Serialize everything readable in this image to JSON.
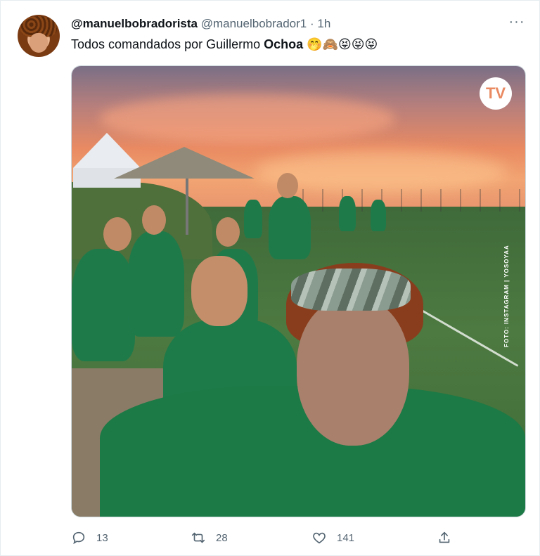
{
  "tweet": {
    "display_name": "@manuelbobradorista",
    "handle": "@manuelbobrador1",
    "separator": "·",
    "time": "1h",
    "more_label": "···",
    "text_before": "Todos comandados por Guillermo ",
    "text_bold": "Ochoa",
    "text_emojis": "🤭🙈😝😝😝"
  },
  "media": {
    "logo_text": "TV",
    "photo_credit": "FOTO: INSTAGRAM | YOSOYAA"
  },
  "actions": {
    "reply_count": "13",
    "retweet_count": "28",
    "like_count": "141"
  },
  "icons": {
    "reply": "reply-icon",
    "retweet": "retweet-icon",
    "like": "heart-icon",
    "share": "share-icon",
    "more": "more-icon"
  },
  "colors": {
    "text_primary": "#0f1419",
    "text_secondary": "#536471",
    "border": "#cfd9de"
  }
}
